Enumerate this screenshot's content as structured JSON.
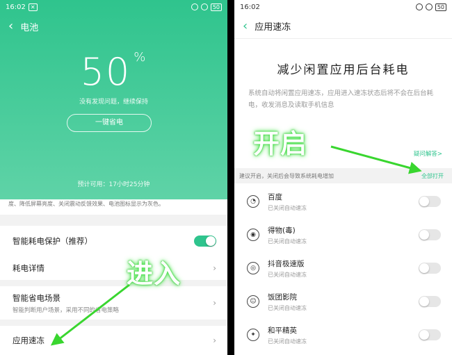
{
  "left": {
    "status_time": "16:02",
    "status_badge": "✕",
    "battery": "50",
    "title": "电池",
    "percent": "50",
    "percent_sign": "%",
    "hint": "没有发现问题，继续保持",
    "save_button": "一键省电",
    "estimate": "预计可用：17小时25分钟",
    "desc_top": "度、降低屏幕亮度、关闭震动反馈效果、电池图标显示为灰色。",
    "rows": [
      {
        "label": "智能耗电保护（推荐）"
      },
      {
        "label": "耗电详情"
      },
      {
        "label": "智能省电场景",
        "sub": "智能判断用户场景，采用不同的省电策略"
      },
      {
        "label": "应用速冻"
      }
    ],
    "annotation": "进入"
  },
  "right": {
    "status_time": "16:02",
    "battery": "50",
    "title": "应用速冻",
    "headline": "减少闲置应用后台耗电",
    "description": "系统自动将闲置应用速冻，应用进入速冻状态后将不会在后台耗电，收发消息及读取手机信息",
    "more": "疑问解答>",
    "suggest": "建议开启，关闭后会导致系统耗电增加",
    "open_all": "全部打开",
    "apps": [
      {
        "name": "百度",
        "status": "已关闭自动速冻",
        "icon": "baidu-icon"
      },
      {
        "name": "得物(毒)",
        "status": "已关闭自动速冻",
        "icon": "dewu-icon"
      },
      {
        "name": "抖音极速版",
        "status": "已关闭自动速冻",
        "icon": "douyin-icon"
      },
      {
        "name": "饭团影院",
        "status": "已关闭自动速冻",
        "icon": "fantuan-icon"
      },
      {
        "name": "和平精英",
        "status": "已关闭自动速冻",
        "icon": "game-icon"
      }
    ],
    "annotation": "开启"
  },
  "colors": {
    "accent": "#2fc48d",
    "annotation_glow": "#49e34b",
    "arrow": "#39d62f"
  }
}
